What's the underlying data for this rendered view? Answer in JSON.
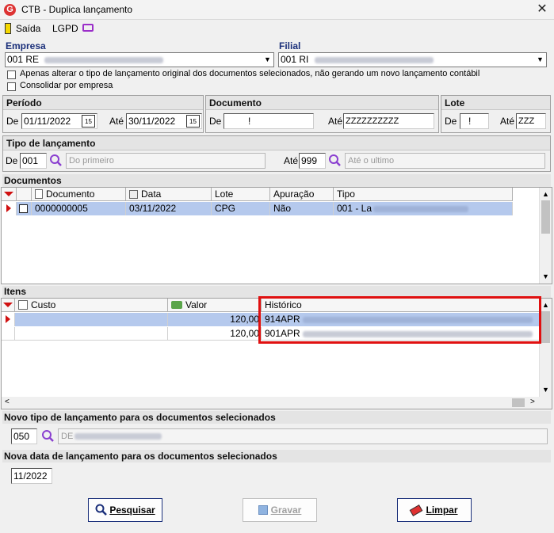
{
  "window": {
    "title": "CTB - Duplica lançamento",
    "close": "✕"
  },
  "toolbar": {
    "saida": "Saída",
    "lgpd": "LGPD"
  },
  "empresa": {
    "label": "Empresa",
    "value_prefix": "001 RE"
  },
  "filial": {
    "label": "Filial",
    "value_prefix": "001 RI"
  },
  "options": {
    "alterar": "Apenas alterar o tipo de lançamento original dos documentos selecionados, não gerando um novo lançamento contábil",
    "consolidar": "Consolidar por empresa"
  },
  "periodo": {
    "label": "Período",
    "de_label": "De",
    "de": "01/11/2022",
    "ate_label": "Até",
    "ate": "30/11/2022",
    "cal_icon": "15"
  },
  "documento": {
    "label": "Documento",
    "de_label": "De",
    "de": "!",
    "ate_label": "Até",
    "ate": "ZZZZZZZZZZ"
  },
  "lote": {
    "label": "Lote",
    "de_label": "De",
    "de": "!",
    "ate_label": "Até",
    "ate": "ZZZ"
  },
  "tipo_lancamento": {
    "label": "Tipo de lançamento",
    "de_label": "De",
    "de": "001",
    "de_desc": "Do primeiro",
    "ate_label": "Até",
    "ate": "999",
    "ate_desc": "Até o ultimo"
  },
  "documentos": {
    "label": "Documentos",
    "columns": [
      "Documento",
      "Data",
      "Lote",
      "Apuração",
      "Tipo"
    ],
    "rows": [
      {
        "documento": "0000000005",
        "data": "03/11/2022",
        "lote": "CPG",
        "apuracao": "Não",
        "tipo": "001 - La"
      }
    ]
  },
  "itens": {
    "label": "Itens",
    "columns": [
      "Custo",
      "Valor",
      "Histórico"
    ],
    "rows": [
      {
        "custo": "",
        "valor": "120,00",
        "historico": "914APR"
      },
      {
        "custo": "",
        "valor": "120,00",
        "historico": "901APR"
      }
    ]
  },
  "novo_tipo": {
    "label": "Novo tipo de lançamento para os documentos selecionados",
    "value": "050",
    "desc": "DE"
  },
  "nova_data": {
    "label": "Nova data de lançamento para os documentos selecionados",
    "value": "11/2022"
  },
  "buttons": {
    "pesquisar": "Pesquisar",
    "gravar": "Gravar",
    "limpar": "Limpar"
  },
  "colors": {
    "title_accent": "#1a2f7a",
    "highlight": "#e01010",
    "selection": "#b5c9ed"
  }
}
